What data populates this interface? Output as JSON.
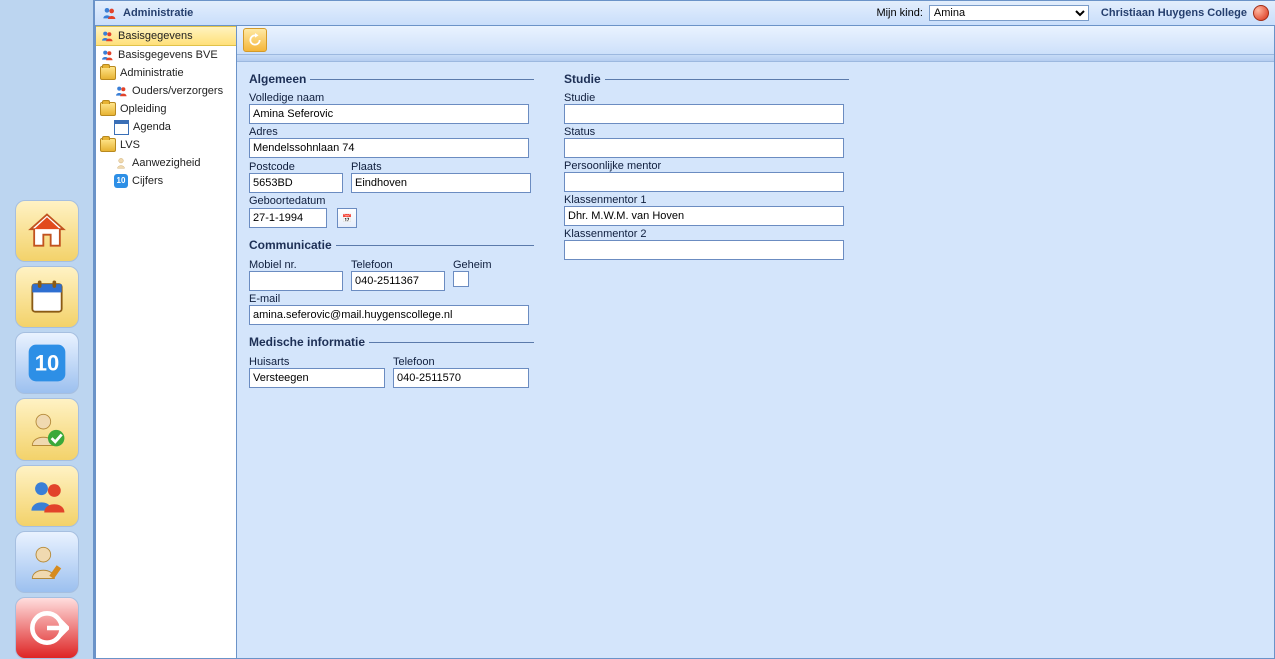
{
  "header": {
    "title": "Administratie",
    "child_label": "Mijn kind:",
    "child_selected": "Amina",
    "school": "Christiaan Huygens College"
  },
  "sidebar": {
    "items": [
      {
        "label": "Basisgegevens",
        "icon": "users",
        "sel": true
      },
      {
        "label": "Basisgegevens BVE",
        "icon": "users"
      },
      {
        "label": "Administratie",
        "icon": "folder"
      },
      {
        "label": "Ouders/verzorgers",
        "icon": "users",
        "indent": true
      },
      {
        "label": "Opleiding",
        "icon": "folder"
      },
      {
        "label": "Agenda",
        "icon": "cal",
        "indent": true
      },
      {
        "label": "LVS",
        "icon": "folder"
      },
      {
        "label": "Aanwezigheid",
        "icon": "person",
        "indent": true
      },
      {
        "label": "Cijfers",
        "icon": "ten",
        "indent": true
      }
    ]
  },
  "form": {
    "algemeen": {
      "legend": "Algemeen",
      "naam_label": "Volledige naam",
      "naam": "Amina Seferovic",
      "adres_label": "Adres",
      "adres": "Mendelssohnlaan 74",
      "postcode_label": "Postcode",
      "postcode": "5653BD",
      "plaats_label": "Plaats",
      "plaats": "Eindhoven",
      "geboorte_label": "Geboortedatum",
      "geboorte": "27-1-1994"
    },
    "communicatie": {
      "legend": "Communicatie",
      "mobiel_label": "Mobiel nr.",
      "mobiel": "",
      "telefoon_label": "Telefoon",
      "telefoon": "040-2511367",
      "geheim_label": "Geheim",
      "email_label": "E-mail",
      "email": "amina.seferovic@mail.huygenscollege.nl"
    },
    "medisch": {
      "legend": "Medische informatie",
      "huisarts_label": "Huisarts",
      "huisarts": "Versteegen",
      "telefoon_label": "Telefoon",
      "telefoon": "040-2511570"
    },
    "studie": {
      "legend": "Studie",
      "studie_label": "Studie",
      "studie": "",
      "status_label": "Status",
      "status": "",
      "mentor_label": "Persoonlijke mentor",
      "mentor": "",
      "km1_label": "Klassenmentor 1",
      "km1": "Dhr. M.W.M. van Hoven",
      "km2_label": "Klassenmentor 2",
      "km2": ""
    }
  }
}
